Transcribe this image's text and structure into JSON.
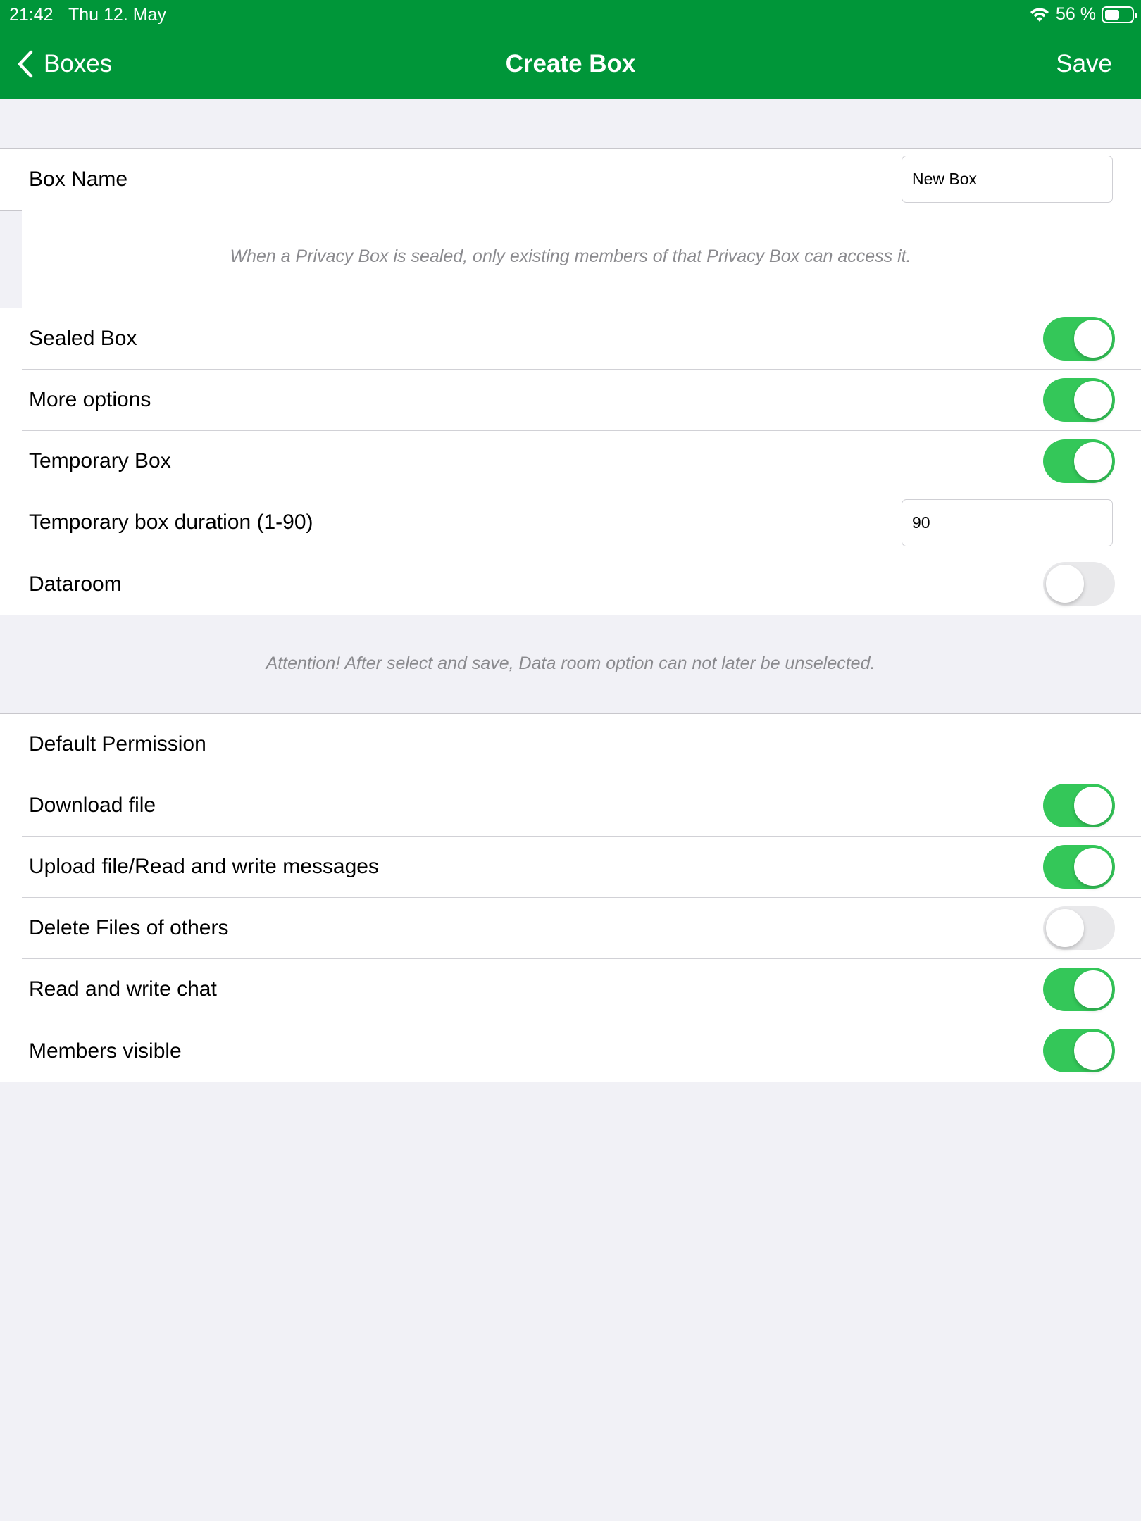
{
  "status_bar": {
    "time": "21:42",
    "date": "Thu 12. May",
    "battery": "56 %",
    "battery_level": 0.56
  },
  "nav": {
    "back_label": "Boxes",
    "title": "Create Box",
    "save_label": "Save"
  },
  "box_name": {
    "label": "Box Name",
    "value": "New Box"
  },
  "sealed_note": "When a Privacy Box is sealed, only existing members of that Privacy Box can access it.",
  "options": {
    "sealed": {
      "label": "Sealed Box",
      "on": true
    },
    "more": {
      "label": "More options",
      "on": true
    },
    "temporary": {
      "label": "Temporary Box",
      "on": true
    },
    "duration": {
      "label": "Temporary box duration (1-90)",
      "value": "90"
    },
    "dataroom": {
      "label": "Dataroom",
      "on": false
    }
  },
  "dataroom_note": "Attention! After select and save, Data room option can not later be unselected.",
  "permissions": {
    "header": "Default Permission",
    "items": [
      {
        "label": "Download file",
        "on": true
      },
      {
        "label": "Upload file/Read and write messages",
        "on": true
      },
      {
        "label": "Delete Files of others",
        "on": false
      },
      {
        "label": "Read and write chat",
        "on": true
      },
      {
        "label": "Members visible",
        "on": true
      }
    ]
  },
  "colors": {
    "header_bg": "#009639",
    "toggle_on": "#34c759",
    "toggle_off": "#e9e9eb",
    "background": "#f1f1f6"
  }
}
